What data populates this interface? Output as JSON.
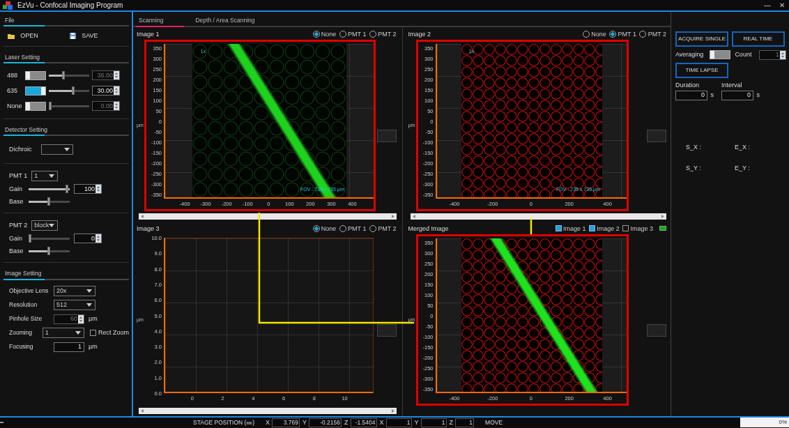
{
  "window": {
    "title": "EzVu - Confocal Imaging Program",
    "controls": [
      "—",
      "✕"
    ]
  },
  "file": {
    "title": "File",
    "buttons": [
      {
        "label": "OPEN",
        "kind": "open"
      },
      {
        "label": "SAVE",
        "kind": "save"
      }
    ]
  },
  "laser": {
    "title": "Laser Setting",
    "rows": [
      {
        "label": "488",
        "on": false,
        "level": 0.36,
        "value": "36.00",
        "disabled": true
      },
      {
        "label": "635",
        "on": true,
        "level": 0.64,
        "value": "30.00",
        "disabled": false
      },
      {
        "label": "None",
        "on": false,
        "level": 0,
        "value": "0.00",
        "disabled": true
      }
    ]
  },
  "detector": {
    "title": "Detector Setting",
    "dichroic": {
      "label": "Dichroic"
    },
    "pmts": [
      {
        "label": "PMT 1",
        "select": "1",
        "gain": {
          "label": "Gain",
          "level": 1,
          "value": "100"
        },
        "base": {
          "label": "Base",
          "level": 0.5
        }
      },
      {
        "label": "PMT 2",
        "select": "block",
        "gain": {
          "label": "Gain",
          "level": 0,
          "value": "0"
        },
        "base": {
          "label": "Base",
          "level": 0.5
        }
      }
    ]
  },
  "image_setting": {
    "title": "Image Setting",
    "fields": [
      {
        "kind": "select",
        "label": "Objective Lens",
        "value": "20x",
        "disabled": false
      },
      {
        "kind": "select",
        "label": "Resolution",
        "value": "512",
        "disabled": false
      },
      {
        "kind": "spin",
        "label": "Pinhole Size",
        "value": "60",
        "unit": "µm",
        "disabled": true
      },
      {
        "kind": "select",
        "label": "Zooming",
        "value": "1",
        "disabled": false,
        "checkbox": {
          "label": "Rect Zoom",
          "checked": false
        }
      },
      {
        "kind": "number",
        "label": "Focusing",
        "value": "1",
        "unit": "µm",
        "disabled": false
      }
    ]
  },
  "tabs": [
    {
      "label": "Scanning",
      "selected": true
    },
    {
      "label": "Depth / Area Scanning",
      "selected": false
    }
  ],
  "panels": [
    {
      "title": "Image 1",
      "kind": "green",
      "options": [
        {
          "label": "None",
          "selected": true
        },
        {
          "label": "PMT 1",
          "selected": false
        },
        {
          "label": "PMT 2",
          "selected": false
        }
      ],
      "y_unit": "µm",
      "zoom_label": "1x",
      "fov": "FOV : 735 x 735 µm",
      "y_ticks": [
        "350",
        "300",
        "250",
        "200",
        "150",
        "100",
        "50",
        "0",
        "-50",
        "-100",
        "-150",
        "-200",
        "-250",
        "-300",
        "-350"
      ],
      "x_ticks": [
        "-400",
        "-300",
        "-200",
        "-100",
        "0",
        "100",
        "200",
        "300",
        "400"
      ]
    },
    {
      "title": "Image 2",
      "kind": "red",
      "options": [
        {
          "label": "None",
          "selected": false
        },
        {
          "label": "PMT 1",
          "selected": true
        },
        {
          "label": "PMT 2",
          "selected": false
        }
      ],
      "y_unit": "µm",
      "zoom_label": "1x",
      "fov": "FOV : 735 x 735 µm",
      "y_ticks": [
        "350",
        "300",
        "250",
        "200",
        "150",
        "100",
        "50",
        "0",
        "-50",
        "-100",
        "-150",
        "-200",
        "-250",
        "-300",
        "-350"
      ],
      "x_ticks": [
        "-400",
        "-200",
        "0",
        "200",
        "400"
      ]
    },
    {
      "title": "Image 3",
      "kind": "empty",
      "options": [
        {
          "label": "None",
          "selected": true
        },
        {
          "label": "PMT 1",
          "selected": false
        },
        {
          "label": "PMT 2",
          "selected": false
        }
      ],
      "y_unit": "µm",
      "y_ticks": [
        "10.0",
        "9.0",
        "8.0",
        "7.0",
        "6.0",
        "5.0",
        "4.0",
        "3.0",
        "2.0",
        "1.0",
        "0.0"
      ],
      "x_ticks": [
        "0",
        "2",
        "4",
        "6",
        "8",
        "10"
      ]
    },
    {
      "title": "Merged Image",
      "kind": "merged",
      "checks": [
        {
          "label": "Image 1",
          "checked": true
        },
        {
          "label": "Image 2",
          "checked": true
        },
        {
          "label": "Image 3",
          "checked": false
        }
      ],
      "y_unit": "µm",
      "y_ticks": [
        "350",
        "300",
        "250",
        "200",
        "150",
        "100",
        "50",
        "0",
        "-50",
        "-100",
        "-150",
        "-200",
        "-250",
        "-300",
        "-350"
      ],
      "x_ticks": [
        "-400",
        "-200",
        "0",
        "200",
        "400"
      ]
    }
  ],
  "acquire": {
    "buttons": [
      "ACQUIRE SINGLE",
      "REAL TIME"
    ],
    "averaging": {
      "label": "Averaging",
      "on": false
    },
    "count": {
      "label": "Count",
      "value": "1"
    },
    "time_lapse": "TIME LAPSE",
    "timing": [
      {
        "label": "Duration",
        "value": "0",
        "unit": "s"
      },
      {
        "label": "Interval",
        "value": "0",
        "unit": "s"
      }
    ],
    "coords": [
      "S_X :",
      "E_X :",
      "S_Y :",
      "E_Y :"
    ]
  },
  "status_bar": {
    "label": "STAGE POSITION (㎜)",
    "fields": [
      {
        "axis": "X",
        "value": "3.769"
      },
      {
        "axis": "Y",
        "value": "-0.2156"
      },
      {
        "axis": "Z",
        "value": "-1.5404"
      },
      {
        "axis": "X",
        "value": "1"
      },
      {
        "axis": "Y",
        "value": "1"
      },
      {
        "axis": "Z",
        "value": "1"
      }
    ],
    "move": "MOVE",
    "progress": {
      "level": 0,
      "text": "0%"
    }
  }
}
